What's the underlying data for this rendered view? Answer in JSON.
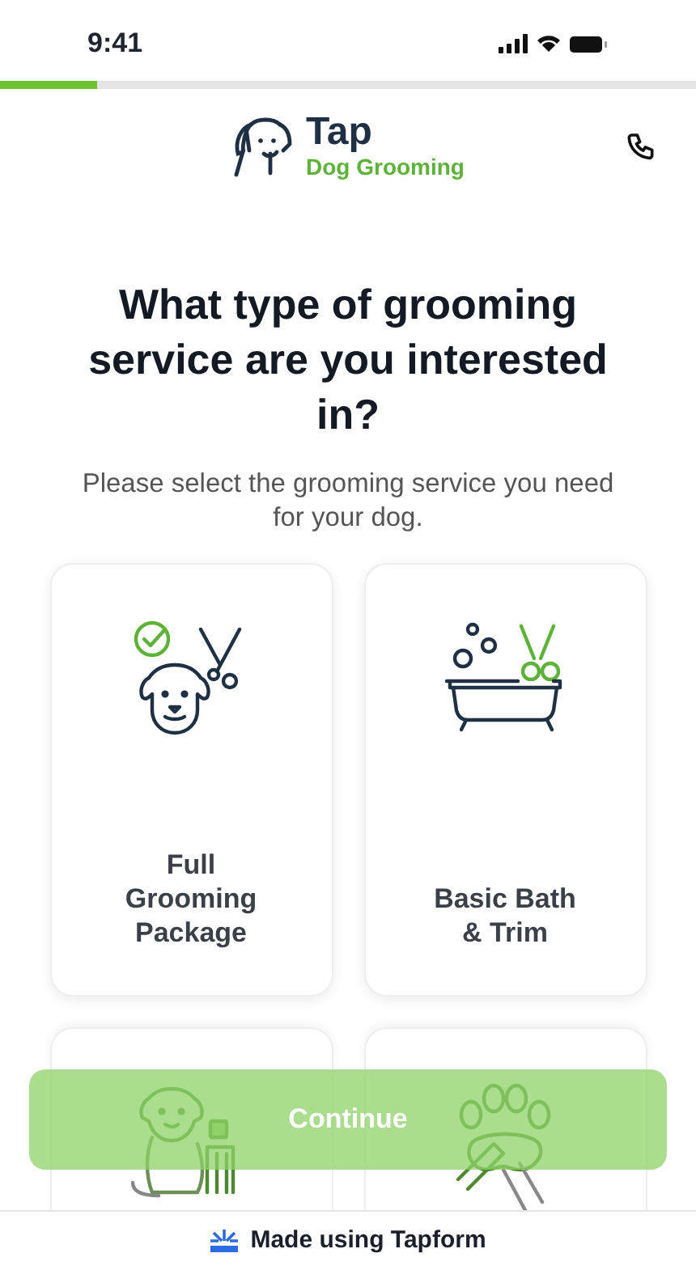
{
  "status_bar": {
    "time": "9:41"
  },
  "progress": {
    "level": 0.14
  },
  "header": {
    "logo_title": "Tap",
    "logo_subtitle": "Dog Grooming"
  },
  "question": {
    "title": "What type of grooming service are you interested in?",
    "subtitle": "Please select the grooming service you need for your dog."
  },
  "options": [
    {
      "label": "Full Grooming Package",
      "selected": false
    },
    {
      "label": "Basic Bath & Trim",
      "selected": false
    },
    {
      "selected": false
    },
    {
      "selected": false
    }
  ],
  "continue_button": {
    "label": "Continue",
    "disabled": true
  },
  "footer": {
    "text": "Made using Tapform"
  }
}
